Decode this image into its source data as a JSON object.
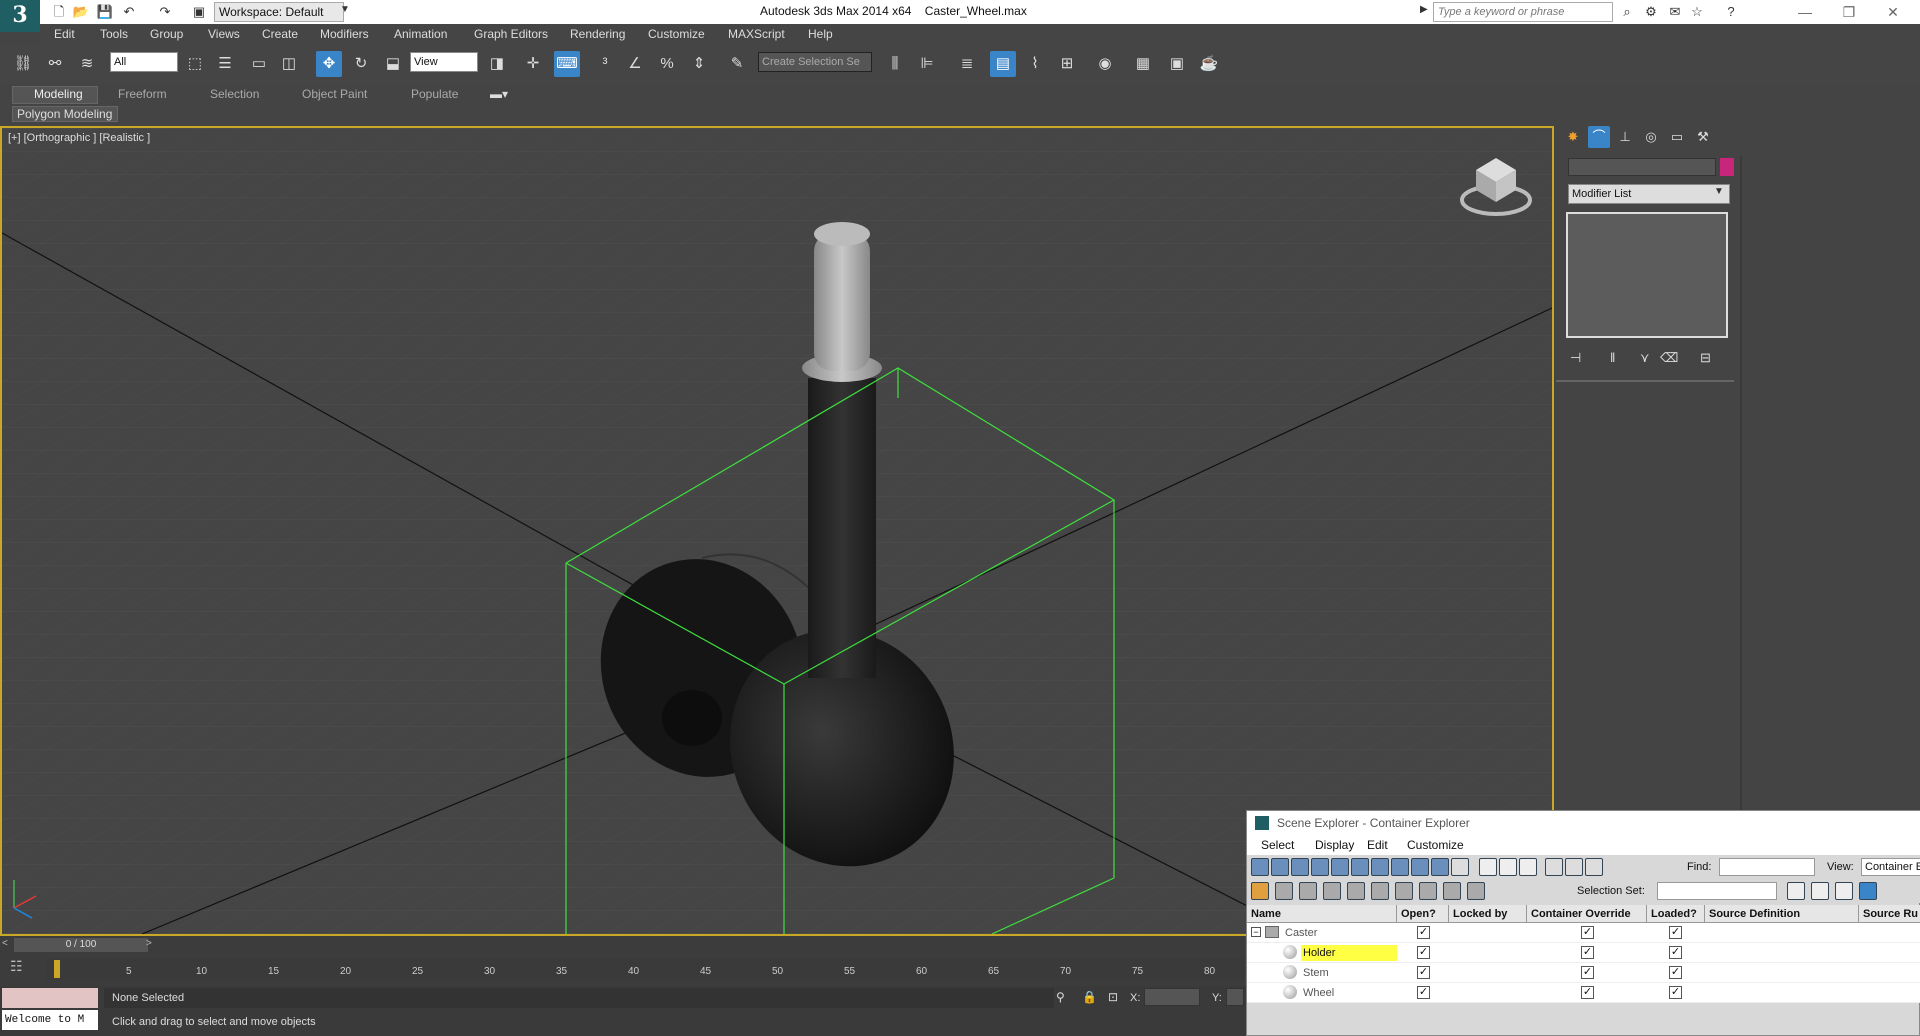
{
  "app": {
    "title": "Autodesk 3ds Max  2014 x64",
    "file": "Caster_Wheel.max",
    "workspace": "Workspace: Default",
    "search_placeholder": "Type a keyword or phrase",
    "logo": "3"
  },
  "menu": [
    "Edit",
    "Tools",
    "Group",
    "Views",
    "Create",
    "Modifiers",
    "Animation",
    "Graph Editors",
    "Rendering",
    "Customize",
    "MAXScript",
    "Help"
  ],
  "toolbar": {
    "filter_value": "All",
    "refcoord_value": "View",
    "selection_set_placeholder": "Create Selection Se"
  },
  "ribbon": {
    "tabs": [
      "Modeling",
      "Freeform",
      "Selection",
      "Object Paint",
      "Populate"
    ],
    "active_tab": "Modeling",
    "panel": "Polygon Modeling"
  },
  "viewport": {
    "label": "[+] [Orthographic ] [Realistic ]"
  },
  "command_panel": {
    "modifier_list": "Modifier List",
    "color_swatch": "#c8267a"
  },
  "timeline": {
    "frame_display": "0 / 100",
    "ticks": [
      "5",
      "10",
      "15",
      "20",
      "25",
      "30",
      "35",
      "40",
      "45",
      "50",
      "55",
      "60",
      "65",
      "70",
      "75",
      "80"
    ]
  },
  "status": {
    "welcome": "Welcome to M",
    "selection": "None Selected",
    "prompt": "Click and drag to select and move objects",
    "x_label": "X:",
    "y_label": "Y:"
  },
  "scene_explorer": {
    "title": "Scene Explorer - Container Explorer",
    "menu": [
      "Select",
      "Display",
      "Edit",
      "Customize"
    ],
    "find_label": "Find:",
    "view_label": "View:",
    "view_value": "Container E",
    "selection_set_label": "Selection Set:",
    "columns": [
      "Name",
      "Open?",
      "Locked by",
      "Container Override",
      "Loaded?",
      "Source Definition",
      "Source Ru"
    ],
    "rows": [
      {
        "name": "Caster",
        "open": true,
        "override": true,
        "loaded": true,
        "level": 0
      },
      {
        "name": "Holder",
        "open": true,
        "override": true,
        "loaded": true,
        "level": 1,
        "highlight": true
      },
      {
        "name": "Stem",
        "open": true,
        "override": true,
        "loaded": true,
        "level": 1
      },
      {
        "name": "Wheel",
        "open": true,
        "override": true,
        "loaded": true,
        "level": 1
      }
    ]
  },
  "colors": {
    "viewport_border": "#c9a826",
    "active_tool": "#3a84c8",
    "selection_box": "#3de03d",
    "highlight_row": "#ffff44"
  }
}
